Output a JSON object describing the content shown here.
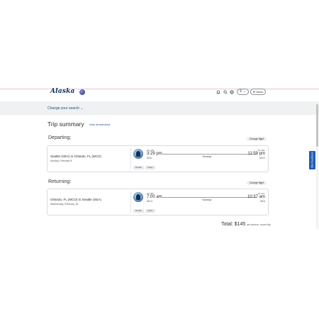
{
  "header": {
    "logo": "Alaska",
    "user_label": "⚲ ⌄",
    "menu_label": "☰ Menu",
    "icons": [
      "bell-icon",
      "search-icon",
      "globe-icon"
    ]
  },
  "search": {
    "change_label": "Change your search ⌄"
  },
  "feedback_label": "Site Feedback",
  "trip": {
    "title": "Trip summary",
    "clear_label": "Clear all selections"
  },
  "departing": {
    "label": "Departing:",
    "change_label": "Change flight",
    "route": "Seattle (SEA) to Orlando, FL (MCO)",
    "date": "Sunday, February 8",
    "flight_number": "AS 748",
    "dep_time": "3:29 pm",
    "dep_code": "SEA",
    "stops": "Nonstop",
    "duration": "5h 30m",
    "arr_time": "11:59 pm",
    "arr_code": "MCO",
    "tags": [
      "Details",
      "Seats"
    ]
  },
  "returning": {
    "label": "Returning:",
    "change_label": "Change flight",
    "route": "Orlando, FL (MCO) to Seattle (SEA)",
    "date": "Wednesday, February 18",
    "flight_number": "AS 356",
    "dep_time": "7:00 am",
    "dep_code": "MCO",
    "stops": "Nonstop",
    "duration": "6h 37m",
    "arr_time": "10:37 am",
    "arr_code": "SEA",
    "tags": [
      "Details",
      "Seats"
    ]
  },
  "total": {
    "label": "Total: $145",
    "sub": "per person, round trip"
  },
  "colors": {
    "brand": "#0b2f5c",
    "link": "#1b4a8c",
    "feedback": "#1e5bb8",
    "band": "#f0f1f2"
  }
}
